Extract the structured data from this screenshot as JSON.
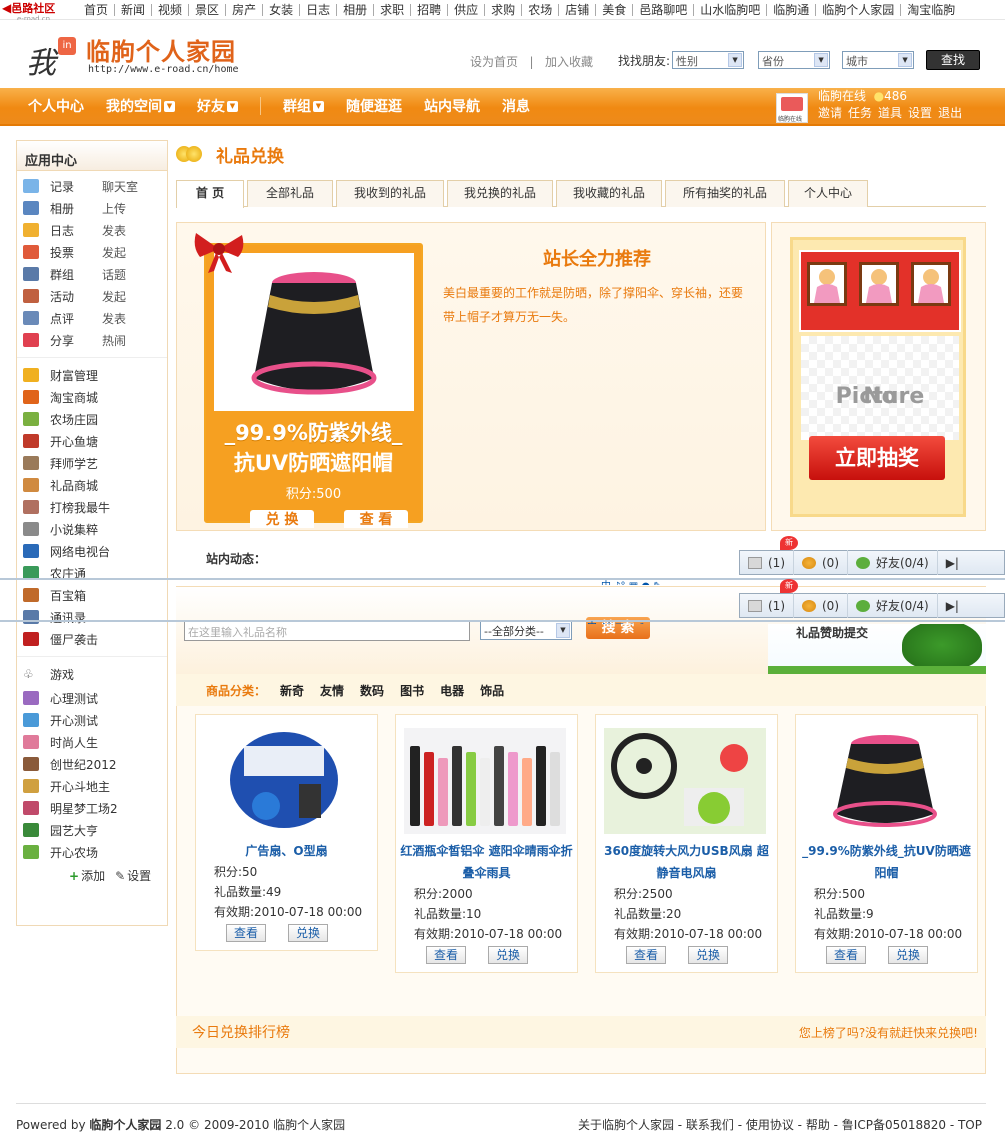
{
  "topbar": {
    "logo_text": "邑路社区",
    "logo_sub": "e-road.cn",
    "links": [
      "首页",
      "新闻",
      "视频",
      "景区",
      "房产",
      "女装",
      "日志",
      "相册",
      "求职",
      "招聘",
      "供应",
      "求购",
      "农场",
      "店铺",
      "美食",
      "邑路聊吧",
      "山水临朐吧",
      "临朐通",
      "临朐个人家园",
      "淘宝临朐"
    ]
  },
  "header": {
    "logo_wo": "我",
    "logo_box": "in",
    "logo_name": "临朐个人家园",
    "logo_url": "http://www.e-road.cn/home",
    "set_home": "设为首页",
    "sep": "|",
    "add_fav": "加入收藏",
    "finder_label": "找找朋友:",
    "gender": "性别",
    "province": "省份",
    "city": "城市",
    "find_button": "查找"
  },
  "nav": {
    "items": [
      {
        "label": "个人中心",
        "dropdown": false
      },
      {
        "label": "我的空间",
        "dropdown": true
      },
      {
        "label": "好友",
        "dropdown": true
      },
      {
        "label": "群组",
        "dropdown": true
      },
      {
        "label": "随便逛逛",
        "dropdown": false
      },
      {
        "label": "站内导航",
        "dropdown": false
      },
      {
        "label": "消息",
        "dropdown": false
      }
    ],
    "user_caption": "临朐在线",
    "user_name": "临朐在线",
    "points": "486",
    "links": [
      "邀请",
      "任务",
      "道具",
      "设置",
      "退出"
    ]
  },
  "sidebar": {
    "title": "应用中心",
    "apps": [
      {
        "a": "记录",
        "b": "聊天室",
        "color": "#7ab4e8"
      },
      {
        "a": "相册",
        "b": "上传",
        "color": "#5a86c0"
      },
      {
        "a": "日志",
        "b": "发表",
        "color": "#f0b030"
      },
      {
        "a": "投票",
        "b": "发起",
        "color": "#e05a3a"
      },
      {
        "a": "群组",
        "b": "话题",
        "color": "#5a7aa8"
      },
      {
        "a": "活动",
        "b": "发起",
        "color": "#c06040"
      },
      {
        "a": "点评",
        "b": "发表",
        "color": "#6a8ab8"
      },
      {
        "a": "分享",
        "b": "热闹",
        "color": "#e04050"
      }
    ],
    "list1": [
      {
        "label": "财富管理",
        "color": "#f0b020"
      },
      {
        "label": "淘宝商城",
        "color": "#e0641a"
      },
      {
        "label": "农场庄园",
        "color": "#7ab040"
      },
      {
        "label": "开心鱼塘",
        "color": "#c03a2a"
      },
      {
        "label": "拜师学艺",
        "color": "#9a7a5a"
      },
      {
        "label": "礼品商城",
        "color": "#d08a40"
      },
      {
        "label": "打榜我最牛",
        "color": "#b07060"
      },
      {
        "label": "小说集粹",
        "color": "#8a8a8a"
      },
      {
        "label": "网络电视台",
        "color": "#2a6ab8"
      },
      {
        "label": "农庄通",
        "color": "#3a9a5a"
      },
      {
        "label": "百宝箱",
        "color": "#c06a2a"
      },
      {
        "label": "通讯录",
        "color": "#5a7aa8"
      },
      {
        "label": "僵尸袭击",
        "color": "#c02020"
      }
    ],
    "games_title": "游戏",
    "games": [
      {
        "label": "心理测试",
        "color": "#9a6ac0"
      },
      {
        "label": "开心测试",
        "color": "#4a9ad8"
      },
      {
        "label": "时尚人生",
        "color": "#e07a9a"
      },
      {
        "label": "创世纪2012",
        "color": "#8a5a3a"
      },
      {
        "label": "开心斗地主",
        "color": "#d0a040"
      },
      {
        "label": "明星梦工场2",
        "color": "#c04a6a"
      },
      {
        "label": "园艺大亨",
        "color": "#3a8a3a"
      },
      {
        "label": "开心农场",
        "color": "#6ab040"
      }
    ],
    "add": "添加",
    "settings": "设置"
  },
  "main": {
    "title": "礼品兑换",
    "tabs": [
      "首 页",
      "全部礼品",
      "我收到的礼品",
      "我兑换的礼品",
      "我收藏的礼品",
      "所有抽奖的礼品",
      "个人中心"
    ],
    "recommend": {
      "gift_line1": "_99.9%防紫外线_",
      "gift_line2": "抗UV防晒遮阳帽",
      "points": "积分:500",
      "exchange": "兑 换",
      "view": "查 看",
      "title": "站长全力推荐",
      "desc": "美白最重要的工作就是防晒，除了撑阳伞、穿长袖，还要带上帽子才算万无一失。"
    },
    "lottery": {
      "no_picture_1": "No",
      "no_picture_2": "Picture",
      "button": "立即抽奖"
    },
    "dynamics": "站内动态：",
    "chat": {
      "badge": "新",
      "msg": "(1)",
      "group": "(0)",
      "friends": "好友(0/4)",
      "more": "▶|"
    },
    "ime_text": "中 ♪° ▦ ● ✎",
    "search": {
      "placeholder": "在这里输入礼品名称",
      "category": "--全部分类--",
      "button": "搜 索",
      "ad_text": "礼品赞助提交"
    },
    "category_label": "商品分类：",
    "categories": [
      "新奇",
      "友情",
      "数码",
      "图书",
      "电器",
      "饰品"
    ],
    "products": [
      {
        "name": "广告扇、O型扇",
        "points": "积分:50",
        "qty": "礼品数量:49",
        "expire": "有效期:2010-07-18 00:00",
        "view": "查看",
        "exchange": "兑换"
      },
      {
        "name": "红酒瓶伞皙铝伞 遮阳伞晴雨伞折叠伞雨具",
        "points": "积分:2000",
        "qty": "礼品数量:10",
        "expire": "有效期:2010-07-18 00:00",
        "view": "查看",
        "exchange": "兑换"
      },
      {
        "name": "360度旋转大风力USB风扇 超静音电风扇",
        "points": "积分:2500",
        "qty": "礼品数量:20",
        "expire": "有效期:2010-07-18 00:00",
        "view": "查看",
        "exchange": "兑换"
      },
      {
        "name": "_99.9%防紫外线_抗UV防晒遮阳帽",
        "points": "积分:500",
        "qty": "礼品数量:9",
        "expire": "有效期:2010-07-18 00:00",
        "view": "查看",
        "exchange": "兑换"
      }
    ],
    "rank_title": "今日兑换排行榜",
    "rank_cta": "您上榜了吗?没有就赶快来兑换吧!"
  },
  "footer": {
    "powered": "Powered by",
    "brand": "临朐个人家园",
    "version": "2.0 © 2009-2010 临朐个人家园",
    "right": "关于临朐个人家园 - 联系我们 - 使用协议 - 帮助 - 鲁ICP备05018820 - TOP"
  }
}
